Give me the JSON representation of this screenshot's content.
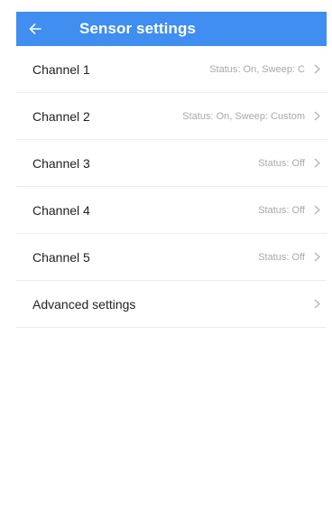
{
  "header": {
    "title": "Sensor settings",
    "bar_color": "#3f8ef0",
    "back_icon": "arrow-left-icon"
  },
  "rows": [
    {
      "label": "Channel 1",
      "value": "Status: On, Sweep: C"
    },
    {
      "label": "Channel 2",
      "value": "Status: On, Sweep: Custom"
    },
    {
      "label": "Channel 3",
      "value": "Status: Off"
    },
    {
      "label": "Channel 4",
      "value": "Status: Off"
    },
    {
      "label": "Channel 5",
      "value": "Status: Off"
    },
    {
      "label": "Advanced settings",
      "value": ""
    }
  ],
  "chevron_icon": "chevron-right-icon"
}
